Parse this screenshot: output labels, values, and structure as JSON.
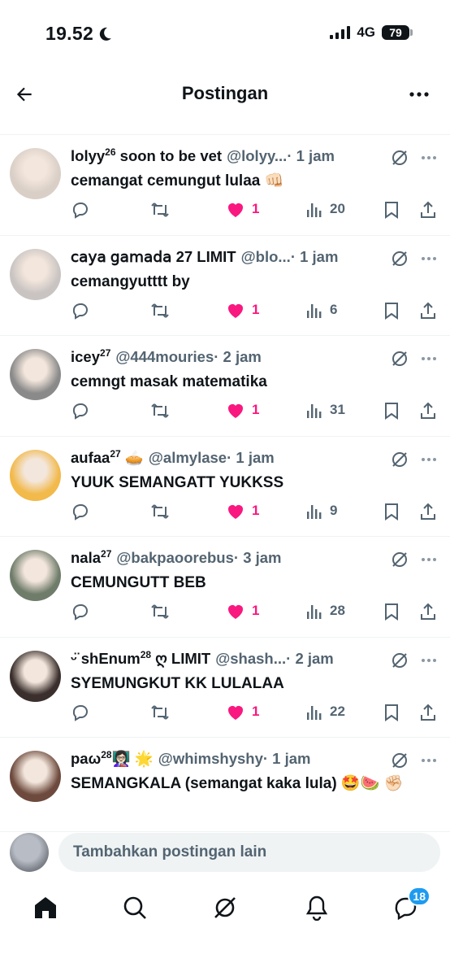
{
  "status_bar": {
    "time": "19.52",
    "network": "4G",
    "battery": "79"
  },
  "header": {
    "title": "Postingan"
  },
  "posts": [
    {
      "name": "lolyy",
      "sup": "26",
      "name_suffix": " soon to be vet",
      "handle": "@lolyy...",
      "time": "· 1 jam",
      "text": "cemangat cemungut lulaa 👊🏻",
      "likes": "1",
      "views": "20",
      "avatar_color": "#d9cfc7"
    },
    {
      "name": "𝖼𝖺𝗒𝖺 𝗀𝖺𝗆𝖺𝖽𝖺 27 LIMIT",
      "sup": "",
      "name_suffix": "",
      "handle": "@blo...",
      "time": "· 1 jam",
      "text": "cemangyutttt by",
      "likes": "1",
      "views": "6",
      "avatar_color": "#c9c4c2"
    },
    {
      "name": "icey",
      "sup": "27",
      "name_suffix": "",
      "handle": "@444mouries",
      "time": "· 2 jam",
      "text": "cemngt masak matematika",
      "likes": "1",
      "views": "31",
      "avatar_color": "#8a8a8a"
    },
    {
      "name": "aufaa",
      "sup": "27",
      "name_suffix": " 🥧",
      "handle": "@almylase",
      "time": "· 1 jam",
      "text": "YUUK SEMANGATT YUKKSS",
      "likes": "1",
      "views": "9",
      "avatar_color": "#f2b94b"
    },
    {
      "name": "nala",
      "sup": "27",
      "name_suffix": "",
      "handle": "@bakpaoorebus",
      "time": "· 3 jam",
      "text": "CEMUNGUTT BEB",
      "likes": "1",
      "views": "28",
      "avatar_color": "#6f7c6a"
    },
    {
      "name": "ᵕ̈ shEnum",
      "sup": "28",
      "name_suffix": " ღ LIMIT",
      "handle": "@shash...",
      "time": "· 2 jam",
      "text": "SYEMUNGKUT KK LULALAA",
      "likes": "1",
      "views": "22",
      "avatar_color": "#3a2f2c"
    },
    {
      "name": "paω",
      "sup": "28",
      "name_suffix": "👩🏻‍🏫 🌟",
      "handle": "@whimshyshy",
      "time": "· 1 jam",
      "text": "SEMANGKALA (semangat kaka lula) 🤩🍉 ✊🏻",
      "likes": "",
      "views": "",
      "avatar_color": "#6d4a3d"
    }
  ],
  "reply": {
    "placeholder": "Tambahkan postingan lain"
  },
  "tabs": {
    "messages_badge": "18"
  },
  "colors": {
    "accent": "#1d9bf0",
    "like": "#f91880",
    "muted": "#536471"
  }
}
